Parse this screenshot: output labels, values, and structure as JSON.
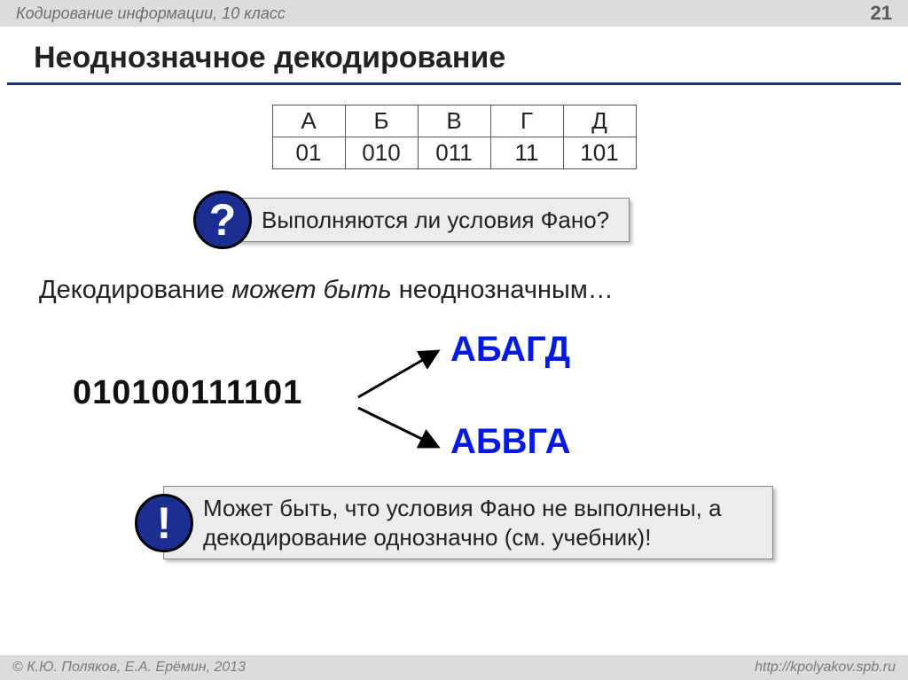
{
  "header": {
    "breadcrumb": "Кодирование информации, 10 класс",
    "page": "21"
  },
  "title": "Неоднозначное декодирование",
  "table": {
    "letters": [
      "А",
      "Б",
      "В",
      "Г",
      "Д"
    ],
    "codes": [
      "01",
      "010",
      "011",
      "11",
      "101"
    ]
  },
  "question": {
    "badge": "?",
    "text": "Выполняются ли условия Фано?"
  },
  "statement_prefix": "Декодирование ",
  "statement_em": "может быть",
  "statement_suffix": " неоднозначным…",
  "fork": {
    "code": "010100111101",
    "decode1": "АБАГД",
    "decode2": "АБВГА"
  },
  "note": {
    "badge": "!",
    "text": "Может быть, что условия Фано не выполнены, а декодирование однозначно (см. учебник)!"
  },
  "footer": {
    "left": "© К.Ю. Поляков, Е.А. Ерёмин, 2013",
    "right": "http://kpolyakov.spb.ru"
  }
}
